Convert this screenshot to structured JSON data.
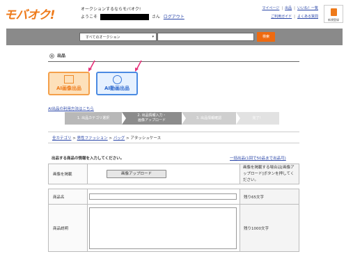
{
  "header": {
    "logo": "モバオク!",
    "welcome_line1": "オークションするならモバオク!",
    "welcome_prefix": "ようこそ",
    "welcome_suffix": "さん",
    "logout": "ログアウト",
    "links_row1": [
      "マイページ",
      "出品",
      "いいね！一覧"
    ],
    "links_row2": [
      "ご利用ガイド",
      "よくある質問"
    ],
    "register_label": "新規登録"
  },
  "search": {
    "category_selected": "すべてのオークション",
    "query": "",
    "button": "検索"
  },
  "page": {
    "title": "出品",
    "ai_image_button": "AI画像出品",
    "ai_video_button": "AI動画出品",
    "ai_help_link": "AI出品の利用方法はこちら"
  },
  "steps": [
    "1. 出品カテゴリ選択",
    "2. 出品情報入力・",
    "画像アップロード",
    "3. 出品情報確認",
    "完了！"
  ],
  "breadcrumb": {
    "items": [
      "全カテゴリ",
      "男性ファッション",
      "バッグ"
    ],
    "current": "アタッシュケース",
    "separator": ">"
  },
  "form": {
    "instruction": "出品する商品の情報を入力してください。",
    "bulk_link": "一括出品(1回で50品まで出品可)",
    "image_label": "画像を掲載",
    "upload_button": "画像アップロード",
    "upload_note": "画像を掲載する場合は[画像アップロード]ボタンを押してください。",
    "name_label": "商品名",
    "name_value": "",
    "name_remaining": "残り65文字",
    "desc_label": "商品説明",
    "desc_value": "",
    "desc_remaining": "残り1000文字"
  },
  "colors": {
    "brand": "#ee7a1a",
    "search_button": "#ee6a10",
    "link": "#2a46a8",
    "arrow_annotation": "#e8317a",
    "ai_image_bg": "#fde0ba",
    "ai_video_border": "#4a8ae2"
  }
}
